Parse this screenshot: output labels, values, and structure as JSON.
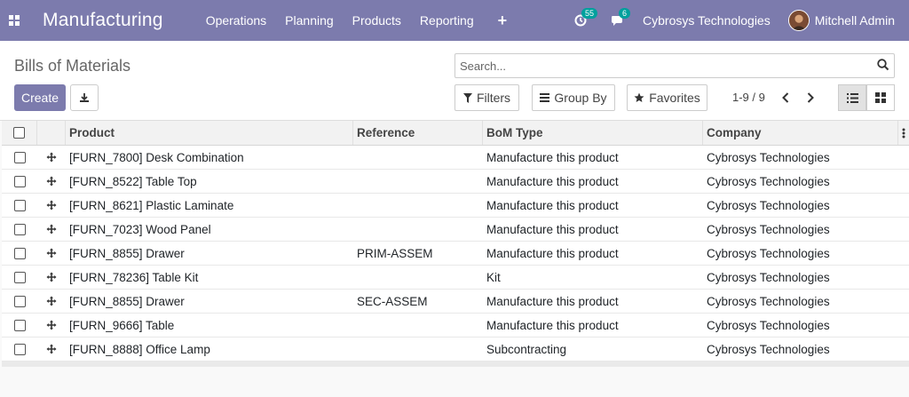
{
  "navbar": {
    "app_title": "Manufacturing",
    "menu": [
      "Operations",
      "Planning",
      "Products",
      "Reporting"
    ],
    "plus": "+",
    "activity_badge": "55",
    "messages_badge": "6",
    "company": "Cybrosys Technologies",
    "user": "Mitchell Admin"
  },
  "control_panel": {
    "breadcrumb": "Bills of Materials",
    "search_placeholder": "Search...",
    "create_label": "Create",
    "filters_label": "Filters",
    "groupby_label": "Group By",
    "favorites_label": "Favorites",
    "pager": "1-9 / 9"
  },
  "table": {
    "columns": [
      "Product",
      "Reference",
      "BoM Type",
      "Company"
    ],
    "rows": [
      {
        "product": "[FURN_7800] Desk Combination",
        "reference": "",
        "bom_type": "Manufacture this product",
        "company": "Cybrosys Technologies"
      },
      {
        "product": "[FURN_8522] Table Top",
        "reference": "",
        "bom_type": "Manufacture this product",
        "company": "Cybrosys Technologies"
      },
      {
        "product": "[FURN_8621] Plastic Laminate",
        "reference": "",
        "bom_type": "Manufacture this product",
        "company": "Cybrosys Technologies"
      },
      {
        "product": "[FURN_7023] Wood Panel",
        "reference": "",
        "bom_type": "Manufacture this product",
        "company": "Cybrosys Technologies"
      },
      {
        "product": "[FURN_8855] Drawer",
        "reference": "PRIM-ASSEM",
        "bom_type": "Manufacture this product",
        "company": "Cybrosys Technologies"
      },
      {
        "product": "[FURN_78236] Table Kit",
        "reference": "",
        "bom_type": "Kit",
        "company": "Cybrosys Technologies"
      },
      {
        "product": "[FURN_8855] Drawer",
        "reference": "SEC-ASSEM",
        "bom_type": "Manufacture this product",
        "company": "Cybrosys Technologies"
      },
      {
        "product": "[FURN_9666] Table",
        "reference": "",
        "bom_type": "Manufacture this product",
        "company": "Cybrosys Technologies"
      },
      {
        "product": "[FURN_8888] Office Lamp",
        "reference": "",
        "bom_type": "Subcontracting",
        "company": "Cybrosys Technologies"
      }
    ]
  },
  "colors": {
    "brand": "#7c7bad",
    "badge": "#00a09d"
  },
  "icons": {
    "apps": "apps-grid-icon",
    "activity": "clock-icon",
    "messages": "chat-icon",
    "search": "search-icon",
    "download": "download-icon",
    "filters": "funnel-icon",
    "groupby": "bars-icon",
    "favorites": "star-icon",
    "list_view": "list-icon",
    "kanban_view": "kanban-icon",
    "drag": "drag-handle-icon",
    "optional_columns": "vertical-dots-icon"
  }
}
